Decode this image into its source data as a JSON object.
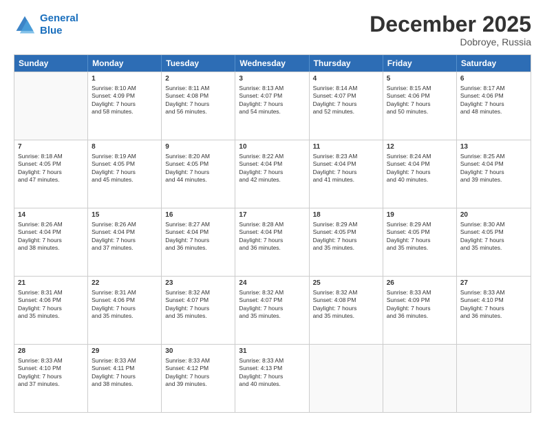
{
  "logo": {
    "line1": "General",
    "line2": "Blue"
  },
  "title": "December 2025",
  "location": "Dobroye, Russia",
  "header_days": [
    "Sunday",
    "Monday",
    "Tuesday",
    "Wednesday",
    "Thursday",
    "Friday",
    "Saturday"
  ],
  "rows": [
    [
      {
        "day": "",
        "lines": []
      },
      {
        "day": "1",
        "lines": [
          "Sunrise: 8:10 AM",
          "Sunset: 4:09 PM",
          "Daylight: 7 hours",
          "and 58 minutes."
        ]
      },
      {
        "day": "2",
        "lines": [
          "Sunrise: 8:11 AM",
          "Sunset: 4:08 PM",
          "Daylight: 7 hours",
          "and 56 minutes."
        ]
      },
      {
        "day": "3",
        "lines": [
          "Sunrise: 8:13 AM",
          "Sunset: 4:07 PM",
          "Daylight: 7 hours",
          "and 54 minutes."
        ]
      },
      {
        "day": "4",
        "lines": [
          "Sunrise: 8:14 AM",
          "Sunset: 4:07 PM",
          "Daylight: 7 hours",
          "and 52 minutes."
        ]
      },
      {
        "day": "5",
        "lines": [
          "Sunrise: 8:15 AM",
          "Sunset: 4:06 PM",
          "Daylight: 7 hours",
          "and 50 minutes."
        ]
      },
      {
        "day": "6",
        "lines": [
          "Sunrise: 8:17 AM",
          "Sunset: 4:06 PM",
          "Daylight: 7 hours",
          "and 48 minutes."
        ]
      }
    ],
    [
      {
        "day": "7",
        "lines": [
          "Sunrise: 8:18 AM",
          "Sunset: 4:05 PM",
          "Daylight: 7 hours",
          "and 47 minutes."
        ]
      },
      {
        "day": "8",
        "lines": [
          "Sunrise: 8:19 AM",
          "Sunset: 4:05 PM",
          "Daylight: 7 hours",
          "and 45 minutes."
        ]
      },
      {
        "day": "9",
        "lines": [
          "Sunrise: 8:20 AM",
          "Sunset: 4:05 PM",
          "Daylight: 7 hours",
          "and 44 minutes."
        ]
      },
      {
        "day": "10",
        "lines": [
          "Sunrise: 8:22 AM",
          "Sunset: 4:04 PM",
          "Daylight: 7 hours",
          "and 42 minutes."
        ]
      },
      {
        "day": "11",
        "lines": [
          "Sunrise: 8:23 AM",
          "Sunset: 4:04 PM",
          "Daylight: 7 hours",
          "and 41 minutes."
        ]
      },
      {
        "day": "12",
        "lines": [
          "Sunrise: 8:24 AM",
          "Sunset: 4:04 PM",
          "Daylight: 7 hours",
          "and 40 minutes."
        ]
      },
      {
        "day": "13",
        "lines": [
          "Sunrise: 8:25 AM",
          "Sunset: 4:04 PM",
          "Daylight: 7 hours",
          "and 39 minutes."
        ]
      }
    ],
    [
      {
        "day": "14",
        "lines": [
          "Sunrise: 8:26 AM",
          "Sunset: 4:04 PM",
          "Daylight: 7 hours",
          "and 38 minutes."
        ]
      },
      {
        "day": "15",
        "lines": [
          "Sunrise: 8:26 AM",
          "Sunset: 4:04 PM",
          "Daylight: 7 hours",
          "and 37 minutes."
        ]
      },
      {
        "day": "16",
        "lines": [
          "Sunrise: 8:27 AM",
          "Sunset: 4:04 PM",
          "Daylight: 7 hours",
          "and 36 minutes."
        ]
      },
      {
        "day": "17",
        "lines": [
          "Sunrise: 8:28 AM",
          "Sunset: 4:04 PM",
          "Daylight: 7 hours",
          "and 36 minutes."
        ]
      },
      {
        "day": "18",
        "lines": [
          "Sunrise: 8:29 AM",
          "Sunset: 4:05 PM",
          "Daylight: 7 hours",
          "and 35 minutes."
        ]
      },
      {
        "day": "19",
        "lines": [
          "Sunrise: 8:29 AM",
          "Sunset: 4:05 PM",
          "Daylight: 7 hours",
          "and 35 minutes."
        ]
      },
      {
        "day": "20",
        "lines": [
          "Sunrise: 8:30 AM",
          "Sunset: 4:05 PM",
          "Daylight: 7 hours",
          "and 35 minutes."
        ]
      }
    ],
    [
      {
        "day": "21",
        "lines": [
          "Sunrise: 8:31 AM",
          "Sunset: 4:06 PM",
          "Daylight: 7 hours",
          "and 35 minutes."
        ]
      },
      {
        "day": "22",
        "lines": [
          "Sunrise: 8:31 AM",
          "Sunset: 4:06 PM",
          "Daylight: 7 hours",
          "and 35 minutes."
        ]
      },
      {
        "day": "23",
        "lines": [
          "Sunrise: 8:32 AM",
          "Sunset: 4:07 PM",
          "Daylight: 7 hours",
          "and 35 minutes."
        ]
      },
      {
        "day": "24",
        "lines": [
          "Sunrise: 8:32 AM",
          "Sunset: 4:07 PM",
          "Daylight: 7 hours",
          "and 35 minutes."
        ]
      },
      {
        "day": "25",
        "lines": [
          "Sunrise: 8:32 AM",
          "Sunset: 4:08 PM",
          "Daylight: 7 hours",
          "and 35 minutes."
        ]
      },
      {
        "day": "26",
        "lines": [
          "Sunrise: 8:33 AM",
          "Sunset: 4:09 PM",
          "Daylight: 7 hours",
          "and 36 minutes."
        ]
      },
      {
        "day": "27",
        "lines": [
          "Sunrise: 8:33 AM",
          "Sunset: 4:10 PM",
          "Daylight: 7 hours",
          "and 36 minutes."
        ]
      }
    ],
    [
      {
        "day": "28",
        "lines": [
          "Sunrise: 8:33 AM",
          "Sunset: 4:10 PM",
          "Daylight: 7 hours",
          "and 37 minutes."
        ]
      },
      {
        "day": "29",
        "lines": [
          "Sunrise: 8:33 AM",
          "Sunset: 4:11 PM",
          "Daylight: 7 hours",
          "and 38 minutes."
        ]
      },
      {
        "day": "30",
        "lines": [
          "Sunrise: 8:33 AM",
          "Sunset: 4:12 PM",
          "Daylight: 7 hours",
          "and 39 minutes."
        ]
      },
      {
        "day": "31",
        "lines": [
          "Sunrise: 8:33 AM",
          "Sunset: 4:13 PM",
          "Daylight: 7 hours",
          "and 40 minutes."
        ]
      },
      {
        "day": "",
        "lines": []
      },
      {
        "day": "",
        "lines": []
      },
      {
        "day": "",
        "lines": []
      }
    ]
  ]
}
